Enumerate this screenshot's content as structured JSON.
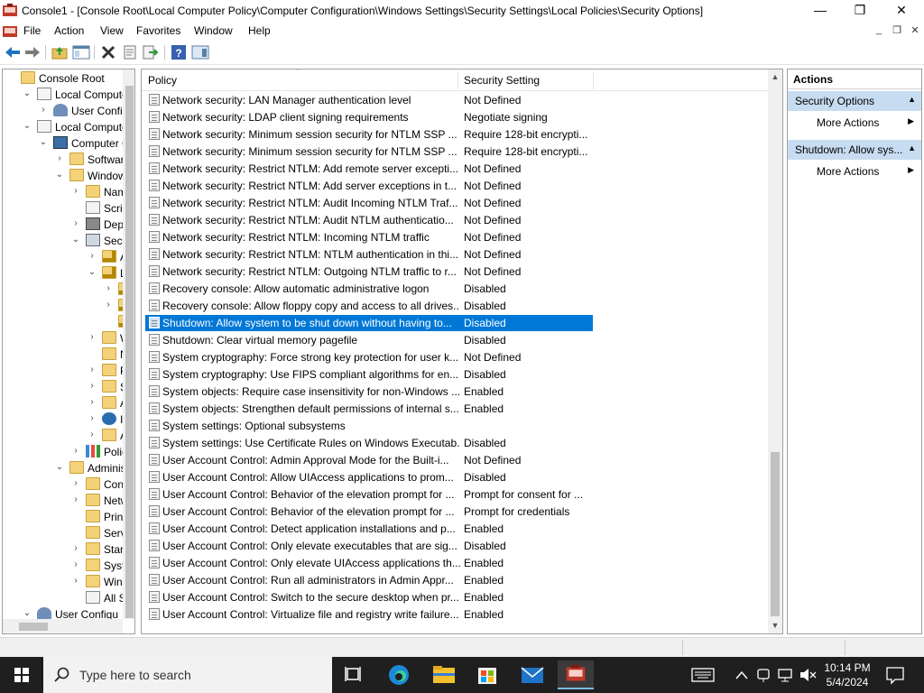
{
  "window": {
    "title": "Console1 - [Console Root\\Local Computer Policy\\Computer Configuration\\Windows Settings\\Security Settings\\Local Policies\\Security Options]",
    "minimize": "—",
    "maximize": "❐",
    "close": "✕"
  },
  "menu": {
    "items": [
      "File",
      "Action",
      "View",
      "Favorites",
      "Window",
      "Help"
    ],
    "mdi_minimize": "_",
    "mdi_restore": "❐",
    "mdi_close": "✕"
  },
  "toolbar": {
    "icons": [
      "back-icon",
      "forward-icon",
      "up-folder-icon",
      "show-hide-tree-icon",
      "delete-icon",
      "properties-icon",
      "export-icon",
      "help-icon",
      "show-action-pane-icon"
    ]
  },
  "tree": {
    "items": [
      {
        "label": "Console Root",
        "arrow": "",
        "icon": "folder"
      },
      {
        "label": "Local Computer",
        "arrow": "⌄",
        "icon": "policy"
      },
      {
        "label": "User Configu",
        "arrow": "›",
        "icon": "user"
      },
      {
        "label": "Local Computer",
        "arrow": "⌄",
        "icon": "policy"
      },
      {
        "label": "Computer Co",
        "arrow": "⌄",
        "icon": "computer"
      },
      {
        "label": "Software",
        "arrow": "›",
        "icon": "folder"
      },
      {
        "label": "Windows",
        "arrow": "⌄",
        "icon": "folder"
      },
      {
        "label": "Name",
        "arrow": "›",
        "icon": "folder"
      },
      {
        "label": "Script",
        "arrow": "",
        "icon": "doc"
      },
      {
        "label": "Deplo",
        "arrow": "›",
        "icon": "printer"
      },
      {
        "label": "Securi",
        "arrow": "⌄",
        "icon": "security"
      },
      {
        "label": "Ac",
        "arrow": "›",
        "icon": "lockfolder"
      },
      {
        "label": "Lo",
        "arrow": "⌄",
        "icon": "lockfolder"
      },
      {
        "label": "",
        "arrow": "›",
        "icon": "lockfolder"
      },
      {
        "label": "",
        "arrow": "›",
        "icon": "lockfolder"
      },
      {
        "label": "",
        "arrow": "",
        "icon": "lockfolder"
      },
      {
        "label": "W",
        "arrow": "›",
        "icon": "folder"
      },
      {
        "label": "Ne",
        "arrow": "",
        "icon": "folder"
      },
      {
        "label": "Pu",
        "arrow": "›",
        "icon": "folder"
      },
      {
        "label": "So",
        "arrow": "›",
        "icon": "folder"
      },
      {
        "label": "Ap",
        "arrow": "›",
        "icon": "folder"
      },
      {
        "label": "IP",
        "arrow": "›",
        "icon": "ipsec"
      },
      {
        "label": "Ac",
        "arrow": "›",
        "icon": "folder"
      },
      {
        "label": "Policy",
        "arrow": "›",
        "icon": "chart"
      },
      {
        "label": "Administ",
        "arrow": "⌄",
        "icon": "folder"
      },
      {
        "label": "Contr",
        "arrow": "›",
        "icon": "folder"
      },
      {
        "label": "Netwo",
        "arrow": "›",
        "icon": "folder"
      },
      {
        "label": "Printe",
        "arrow": "",
        "icon": "folder"
      },
      {
        "label": "Server",
        "arrow": "",
        "icon": "folder"
      },
      {
        "label": "Start M",
        "arrow": "›",
        "icon": "folder"
      },
      {
        "label": "Syster",
        "arrow": "›",
        "icon": "folder"
      },
      {
        "label": "Windo",
        "arrow": "›",
        "icon": "folder"
      },
      {
        "label": "All Set",
        "arrow": "",
        "icon": "doc"
      },
      {
        "label": "User Configu",
        "arrow": "⌄",
        "icon": "user"
      }
    ]
  },
  "list": {
    "columns": {
      "policy": "Policy",
      "setting": "Security Setting"
    },
    "rows": [
      {
        "policy": "Network security: LAN Manager authentication level",
        "setting": "Not Defined"
      },
      {
        "policy": "Network security: LDAP client signing requirements",
        "setting": "Negotiate signing"
      },
      {
        "policy": "Network security: Minimum session security for NTLM SSP ...",
        "setting": "Require 128-bit encrypti..."
      },
      {
        "policy": "Network security: Minimum session security for NTLM SSP ...",
        "setting": "Require 128-bit encrypti..."
      },
      {
        "policy": "Network security: Restrict NTLM: Add remote server excepti...",
        "setting": "Not Defined"
      },
      {
        "policy": "Network security: Restrict NTLM: Add server exceptions in t...",
        "setting": "Not Defined"
      },
      {
        "policy": "Network security: Restrict NTLM: Audit Incoming NTLM Traf...",
        "setting": "Not Defined"
      },
      {
        "policy": "Network security: Restrict NTLM: Audit NTLM authenticatio...",
        "setting": "Not Defined"
      },
      {
        "policy": "Network security: Restrict NTLM: Incoming NTLM traffic",
        "setting": "Not Defined"
      },
      {
        "policy": "Network security: Restrict NTLM: NTLM authentication in thi...",
        "setting": "Not Defined"
      },
      {
        "policy": "Network security: Restrict NTLM: Outgoing NTLM traffic to r...",
        "setting": "Not Defined"
      },
      {
        "policy": "Recovery console: Allow automatic administrative logon",
        "setting": "Disabled"
      },
      {
        "policy": "Recovery console: Allow floppy copy and access to all drives...",
        "setting": "Disabled"
      },
      {
        "policy": "Shutdown: Allow system to be shut down without having to...",
        "setting": "Disabled",
        "selected": true
      },
      {
        "policy": "Shutdown: Clear virtual memory pagefile",
        "setting": "Disabled"
      },
      {
        "policy": "System cryptography: Force strong key protection for user k...",
        "setting": "Not Defined"
      },
      {
        "policy": "System cryptography: Use FIPS compliant algorithms for en...",
        "setting": "Disabled"
      },
      {
        "policy": "System objects: Require case insensitivity for non-Windows ...",
        "setting": "Enabled"
      },
      {
        "policy": "System objects: Strengthen default permissions of internal s...",
        "setting": "Enabled"
      },
      {
        "policy": "System settings: Optional subsystems",
        "setting": ""
      },
      {
        "policy": "System settings: Use Certificate Rules on Windows Executab...",
        "setting": "Disabled"
      },
      {
        "policy": "User Account Control: Admin Approval Mode for the Built-i...",
        "setting": "Not Defined"
      },
      {
        "policy": "User Account Control: Allow UIAccess applications to prom...",
        "setting": "Disabled"
      },
      {
        "policy": "User Account Control: Behavior of the elevation prompt for ...",
        "setting": "Prompt for consent for ..."
      },
      {
        "policy": "User Account Control: Behavior of the elevation prompt for ...",
        "setting": "Prompt for credentials"
      },
      {
        "policy": "User Account Control: Detect application installations and p...",
        "setting": "Enabled"
      },
      {
        "policy": "User Account Control: Only elevate executables that are sig...",
        "setting": "Disabled"
      },
      {
        "policy": "User Account Control: Only elevate UIAccess applications th...",
        "setting": "Enabled"
      },
      {
        "policy": "User Account Control: Run all administrators in Admin Appr...",
        "setting": "Enabled"
      },
      {
        "policy": "User Account Control: Switch to the secure desktop when pr...",
        "setting": "Enabled"
      },
      {
        "policy": "User Account Control: Virtualize file and registry write failure...",
        "setting": "Enabled"
      }
    ]
  },
  "actions": {
    "title": "Actions",
    "section1": "Security Options",
    "section1_more": "More Actions",
    "section2": "Shutdown: Allow sys...",
    "section2_more": "More Actions"
  },
  "taskbar": {
    "search_placeholder": "Type here to search",
    "time": "10:14 PM",
    "date": "5/4/2024",
    "apps": [
      "task-view-icon",
      "edge-icon",
      "file-explorer-icon",
      "store-icon",
      "mail-icon",
      "mmc-icon"
    ]
  },
  "colors": {
    "selection": "#0078d7",
    "action_section": "#c7dcf0",
    "taskbar": "#1f1f1f"
  }
}
